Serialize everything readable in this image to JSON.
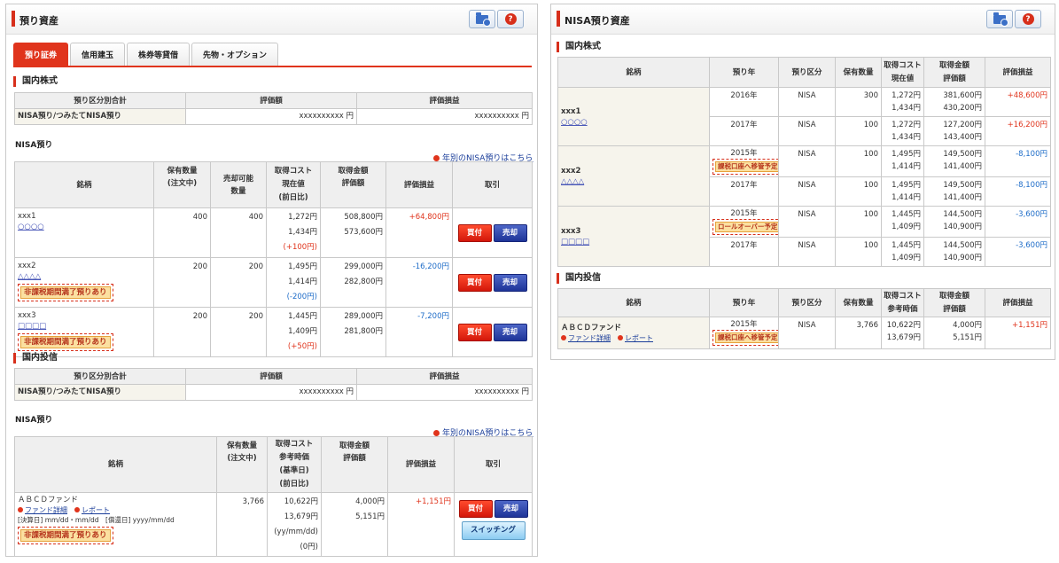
{
  "left": {
    "title": "預り資産",
    "tabs": [
      "預り証券",
      "信用建玉",
      "株券等貸借",
      "先物・オプション"
    ],
    "domestic_stock": {
      "heading": "国内株式",
      "summary": {
        "headers": [
          "預り区分別合計",
          "評価額",
          "評価損益"
        ],
        "row": [
          "NISA預り/つみたてNISA預り",
          "xxxxxxxxxx 円",
          "xxxxxxxxxx 円"
        ]
      },
      "nisa_label": "NISA預り",
      "link": "年別のNISA預りはこちら",
      "headers": {
        "name": "銘柄",
        "qty": "保有数量\n(注文中)",
        "sellable": "売却可能\n数量",
        "cost": "取得コスト\n現在値\n(前日比)",
        "amount": "取得金額\n評価額",
        "pl": "評価損益",
        "trade": "取引"
      },
      "rows": [
        {
          "code": "xxx1",
          "name": "○○○○",
          "qty": "400",
          "sellable": "400",
          "cost": "1,272円",
          "price": "1,434円",
          "diff": "(+100円)",
          "acq": "508,800円",
          "val": "573,600円",
          "pl": "+64,800円",
          "badge": ""
        },
        {
          "code": "xxx2",
          "name": "△△△△",
          "qty": "200",
          "sellable": "200",
          "cost": "1,495円",
          "price": "1,414円",
          "diff": "(-200円)",
          "acq": "299,000円",
          "val": "282,800円",
          "pl": "-16,200円",
          "badge": "非課税期間満了預りあり"
        },
        {
          "code": "xxx3",
          "name": "□□□□",
          "qty": "200",
          "sellable": "200",
          "cost": "1,445円",
          "price": "1,409円",
          "diff": "(+50円)",
          "acq": "289,000円",
          "val": "281,800円",
          "pl": "-7,200円",
          "badge": "非課税期間満了預りあり"
        }
      ]
    },
    "domestic_fund": {
      "heading": "国内投信",
      "summary": {
        "headers": [
          "預り区分別合計",
          "評価額",
          "評価損益"
        ],
        "row": [
          "NISA預り/つみたてNISA預り",
          "xxxxxxxxxx 円",
          "xxxxxxxxxx 円"
        ]
      },
      "nisa_label": "NISA預り",
      "link": "年別のNISA預りはこちら",
      "headers": {
        "name": "銘柄",
        "qty": "保有数量\n(注文中)",
        "cost": "取得コスト\n参考時価\n(基準日)\n(前日比)",
        "amount": "取得金額\n評価額",
        "pl": "評価損益",
        "trade": "取引"
      },
      "row": {
        "name": "ＡＢＣＤファンド",
        "detail_link": "ファンド詳細",
        "report_link": "レポート",
        "dates": "[決算日] mm/dd・mm/dd　[償還日] yyyy/mm/dd",
        "badge": "非課税期間満了預りあり",
        "qty": "3,766",
        "cost": "10,622円",
        "price": "13,679円",
        "base": "(yy/mm/dd)",
        "diff": "(0円)",
        "acq": "4,000円",
        "val": "5,151円",
        "pl": "+1,151円"
      }
    },
    "buttons": {
      "buy": "買付",
      "sell": "売却",
      "switch": "スイッチング"
    }
  },
  "right": {
    "title": "NISA預り資産",
    "domestic_stock": {
      "heading": "国内株式",
      "headers": [
        "銘柄",
        "預り年",
        "預り区分",
        "保有数量",
        "取得コスト\n現在値",
        "取得金額\n評価額",
        "評価損益"
      ],
      "groups": [
        {
          "code": "xxx1",
          "name": "○○○○",
          "rows": [
            {
              "year": "2016年",
              "type": "NISA",
              "qty": "300",
              "cost": "1,272円",
              "price": "1,434円",
              "acq": "381,600円",
              "val": "430,200円",
              "pl": "+48,600円",
              "badge": ""
            },
            {
              "year": "2017年",
              "type": "NISA",
              "qty": "100",
              "cost": "1,272円",
              "price": "1,434円",
              "acq": "127,200円",
              "val": "143,400円",
              "pl": "+16,200円",
              "badge": ""
            }
          ]
        },
        {
          "code": "xxx2",
          "name": "△△△△",
          "rows": [
            {
              "year": "2015年",
              "type": "NISA",
              "qty": "100",
              "cost": "1,495円",
              "price": "1,414円",
              "acq": "149,500円",
              "val": "141,400円",
              "pl": "-8,100円",
              "badge": "課税口座へ移管予定"
            },
            {
              "year": "2017年",
              "type": "NISA",
              "qty": "100",
              "cost": "1,495円",
              "price": "1,414円",
              "acq": "149,500円",
              "val": "141,400円",
              "pl": "-8,100円",
              "badge": ""
            }
          ]
        },
        {
          "code": "xxx3",
          "name": "□□□□",
          "rows": [
            {
              "year": "2015年",
              "type": "NISA",
              "qty": "100",
              "cost": "1,445円",
              "price": "1,409円",
              "acq": "144,500円",
              "val": "140,900円",
              "pl": "-3,600円",
              "badge": "ロールオーバー予定"
            },
            {
              "year": "2017年",
              "type": "NISA",
              "qty": "100",
              "cost": "1,445円",
              "price": "1,409円",
              "acq": "144,500円",
              "val": "140,900円",
              "pl": "-3,600円",
              "badge": ""
            }
          ]
        }
      ]
    },
    "domestic_fund": {
      "heading": "国内投信",
      "headers": [
        "銘柄",
        "預り年",
        "預り区分",
        "保有数量",
        "取得コスト\n参考時価",
        "取得金額\n評価額",
        "評価損益"
      ],
      "row": {
        "name": "ＡＢＣＤファンド",
        "detail_link": "ファンド詳細",
        "report_link": "レポート",
        "year": "2015年",
        "badge": "課税口座へ移管予定",
        "type": "NISA",
        "qty": "3,766",
        "cost": "10,622円",
        "price": "13,679円",
        "acq": "4,000円",
        "val": "5,151円",
        "pl": "+1,151円"
      }
    }
  },
  "icons": {
    "folder": "folder-icon",
    "help": "help-icon",
    "link": "circle-arrow-icon",
    "external": "external-link-icon"
  }
}
